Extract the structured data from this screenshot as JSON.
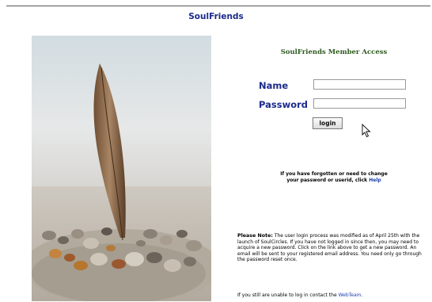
{
  "header": {
    "title": "SoulFriends"
  },
  "login": {
    "section_title": "SoulFriends Member Access",
    "name_label": "Name",
    "password_label": "Password",
    "name_value": "",
    "password_value": "",
    "submit_label": "login"
  },
  "help": {
    "line1": "If you have forgotten or need to change",
    "line2_prefix": "your password or userid, click ",
    "link_label": "Help"
  },
  "note": {
    "heading": "Please Note:",
    "body": " The user login process was modified as of April 25th with the launch of SoulCircles. If you have not logged in since then, you may need to acquire a new password. Click on the link above to get a new password. An email will be sent to your registered email address. You need only go through the password reset once."
  },
  "contact": {
    "prefix": "If you still are unable to log in contact the ",
    "link_label": "WebTeam",
    "suffix": "."
  },
  "colors": {
    "title_blue": "#1b2a8c",
    "section_green": "#2e5a1e",
    "link_blue": "#1b3fa8"
  },
  "icons": {
    "cursor": "mouse-pointer-icon"
  }
}
